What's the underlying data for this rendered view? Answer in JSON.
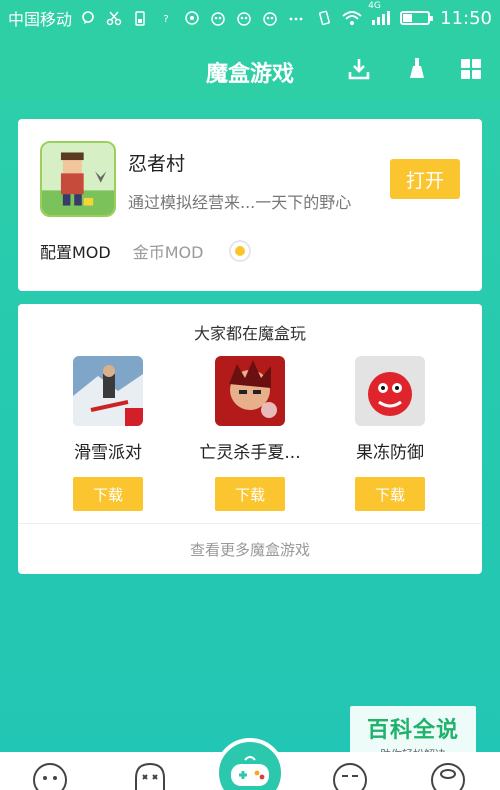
{
  "status_bar": {
    "carrier": "中国移动",
    "network": "4G",
    "time": "11:50",
    "battery_level": 0.35,
    "icons": [
      "chat-icon",
      "scissors-icon",
      "battery-saver-icon",
      "signal-question-icon",
      "game-icon",
      "owl-icon",
      "owl-icon",
      "owl-icon",
      "more-icon",
      "vibrate-icon",
      "wifi-icon",
      "cell-signal-icon"
    ]
  },
  "header": {
    "title": "魔盒游戏",
    "icons": [
      "download-icon",
      "clean-icon",
      "grid-icon"
    ]
  },
  "app_card": {
    "name": "忍者村",
    "description": "通过模拟经营来...一天下的野心",
    "open_label": "打开",
    "mods": [
      "配置MOD",
      "金币MOD"
    ],
    "selected_mod": "配置MOD"
  },
  "recommend": {
    "title": "大家都在魔盒玩",
    "games": [
      {
        "name": "滑雪派对",
        "download_label": "下载",
        "icon": "skiing-game-icon"
      },
      {
        "name": "亡灵杀手夏...",
        "download_label": "下载",
        "icon": "undead-slayer-icon"
      },
      {
        "name": "果冻防御",
        "download_label": "下载",
        "icon": "jelly-defense-icon"
      }
    ],
    "more_label": "查看更多魔盒游戏"
  },
  "watermark": {
    "title": "百科全说",
    "subtitle": "助你轻松解决"
  },
  "bottom_nav": {
    "items": [
      "face-icon",
      "ghost-icon",
      "gamepad-icon",
      "smile-icon",
      "pig-icon"
    ]
  },
  "colors": {
    "accent": "#2fcfa6",
    "button": "#fbc530"
  }
}
